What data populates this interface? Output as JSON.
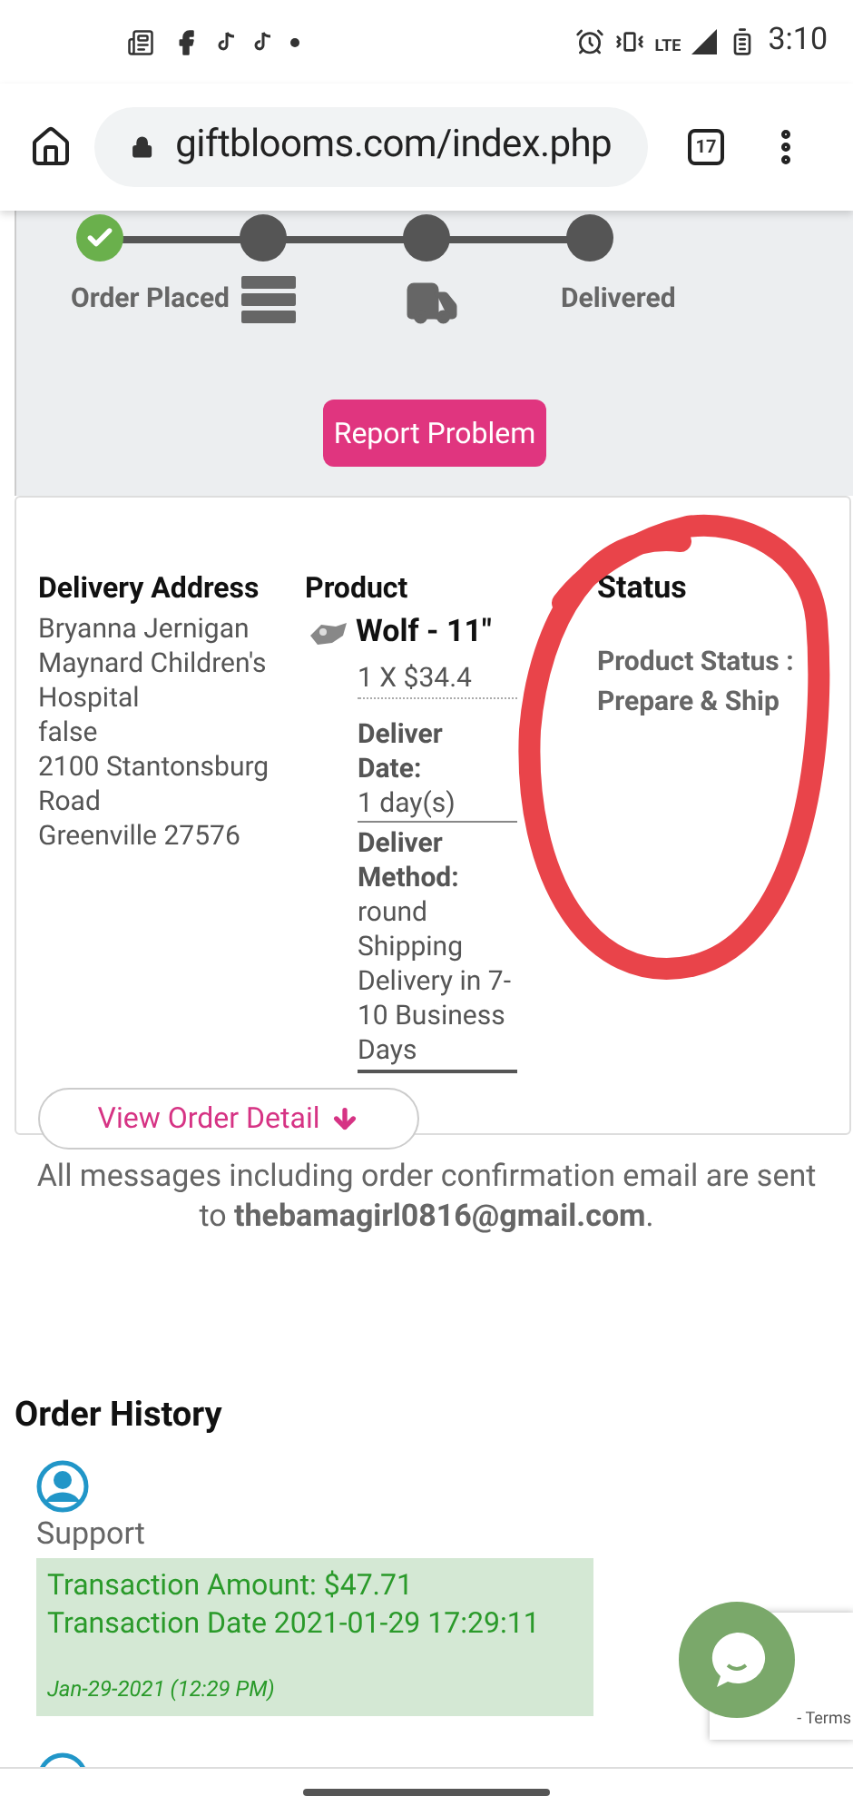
{
  "status_bar": {
    "time": "3:10",
    "network": "LTE"
  },
  "browser": {
    "url": "giftblooms.com/index.php",
    "tab_count": "17"
  },
  "tracker": {
    "steps": [
      {
        "kind": "label",
        "label": "Order Placed",
        "done": true
      },
      {
        "kind": "list",
        "done": false
      },
      {
        "kind": "truck",
        "done": false
      },
      {
        "kind": "label",
        "label": "Delivered",
        "done": false
      }
    ],
    "report_button": "Report Problem"
  },
  "order": {
    "address_heading": "Delivery Address",
    "address_lines": [
      "Bryanna Jernigan",
      "Maynard Children's Hospital",
      "false",
      "2100 Stantonsburg Road",
      "Greenville 27576"
    ],
    "product_heading": "Product",
    "product_name": "Wolf - 11\"",
    "product_price": "1 X $34.4",
    "delivery_date": {
      "label": "Deliver Date:",
      "value": "1 day(s)"
    },
    "delivery_method": {
      "label": "Deliver Method:",
      "value": "round Shipping Delivery in 7-10 Business Days"
    },
    "status_heading": "Status",
    "status_label": "Product Status :",
    "status_value": "Prepare & Ship",
    "detail_button": "View Order Detail"
  },
  "notice": "All messages including order confirmation email are sent to **thebamagirl0816@gmail.com**.",
  "history": {
    "title": "Order History",
    "entries": [
      {
        "author": "Support",
        "lines": [
          "Transaction Amount: $47.71",
          "Transaction Date 2021-01-29 17:29:11"
        ],
        "time": "Jan-29-2021 (12:29 PM)"
      }
    ]
  },
  "recaptcha": {
    "text": "- Terms"
  }
}
